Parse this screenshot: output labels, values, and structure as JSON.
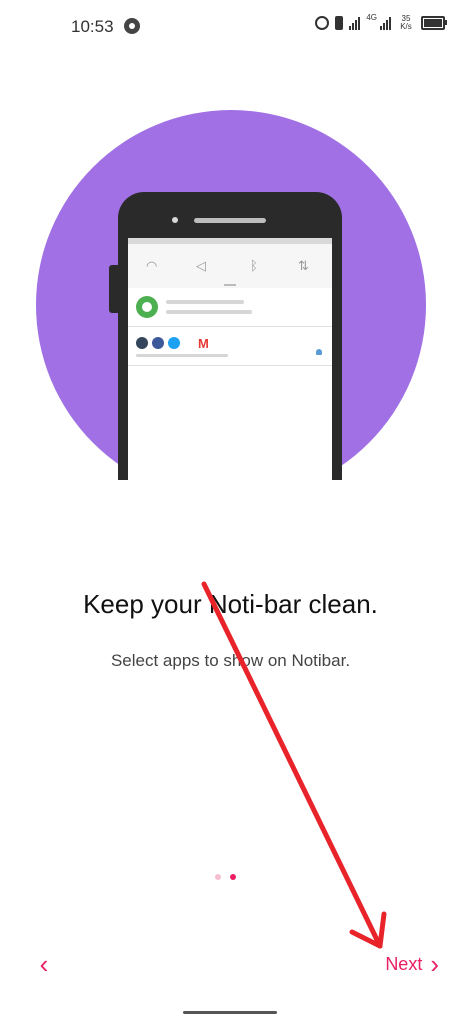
{
  "status_bar": {
    "time": "10:53",
    "net_type": "4G",
    "speed_value": "35",
    "speed_unit": "K/s",
    "icons": [
      "chrome-icon",
      "alarm-icon",
      "vibrate-icon",
      "signal-icon",
      "battery-icon"
    ]
  },
  "onboarding": {
    "title": "Keep your Noti-bar clean.",
    "subtitle": "Select apps to show on Notibar.",
    "page_indicator": {
      "total": 2,
      "current": 2
    }
  },
  "navigation": {
    "prev_icon": "chevron-left-icon",
    "next_label": "Next",
    "next_icon": "chevron-right-icon"
  },
  "colors": {
    "accent": "#e91e63",
    "illustration_circle": "#a070e4",
    "annotation_arrow": "#e8232a"
  }
}
